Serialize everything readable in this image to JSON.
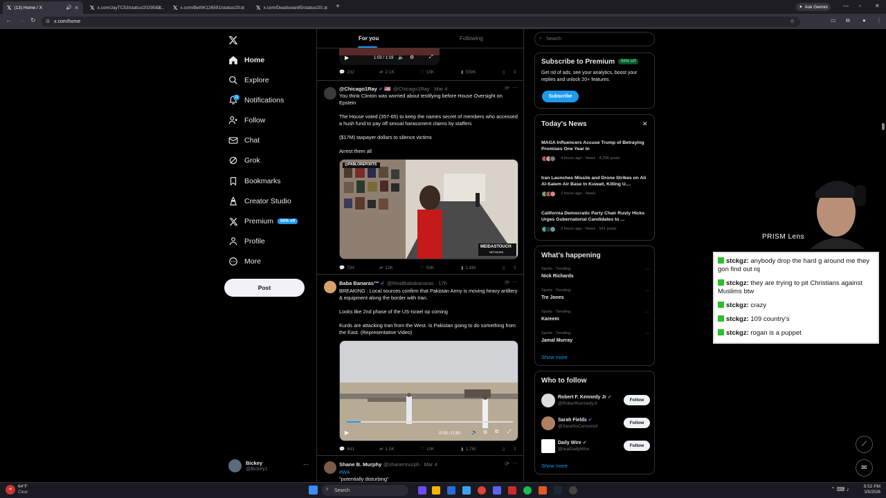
{
  "browser": {
    "tabs": [
      {
        "title": "(13) Home / X",
        "active": true
      },
      {
        "title": "x.com/JayTC53/status/2029583..."
      },
      {
        "title": "x.com/BethK126591/status/20..."
      },
      {
        "title": "x.com/Deadswan85/status/20..."
      }
    ],
    "url": "x.com/home",
    "gemini_label": "Ask Gemini"
  },
  "nav": {
    "items": [
      {
        "label": "Home",
        "icon": "home-icon"
      },
      {
        "label": "Explore",
        "icon": "search-icon"
      },
      {
        "label": "Notifications",
        "icon": "bell-icon"
      },
      {
        "label": "Follow",
        "icon": "person-add-icon"
      },
      {
        "label": "Chat",
        "icon": "mail-icon"
      },
      {
        "label": "Grok",
        "icon": "grok-icon"
      },
      {
        "label": "Bookmarks",
        "icon": "bookmark-icon"
      },
      {
        "label": "Creator Studio",
        "icon": "creator-icon"
      },
      {
        "label": "Premium",
        "icon": "x-logo-icon"
      },
      {
        "label": "Profile",
        "icon": "person-icon"
      },
      {
        "label": "More",
        "icon": "more-circle-icon"
      }
    ],
    "notif_count": "13",
    "premium_badge": "50% off",
    "post_label": "Post",
    "account": {
      "name": "Bickey",
      "handle": "@Bickey1"
    }
  },
  "feed": {
    "tabs": [
      "For you",
      "Following"
    ],
    "top_video": {
      "time": "1:03 / 1:19"
    },
    "top_actions": {
      "replies": "232",
      "reposts": "2.1K",
      "likes": "10K",
      "views": "559K"
    },
    "tweets": [
      {
        "name": "@Chicago1Ray",
        "flag": "🇺🇸",
        "handle": "@Chicago1Ray · Mar 4",
        "paragraphs": [
          "You think Clinton was worried about testifying before House Oversight on Epstein",
          "The House voted (357-65) to keep the names secret of members who accessed a hush fund to pay off sexual harassment claims by staffers",
          "($17M) taxpayer dollars to silence victims",
          "Arrest them all"
        ],
        "media_tag": "@PABLOREPORTS",
        "media_brand": "MEIDASTOUCH",
        "media_brand_sub": "NETWORK",
        "actions": {
          "replies": "794",
          "reposts": "12K",
          "likes": "50K",
          "views": "1.8M"
        }
      },
      {
        "name": "Baba Banaras™",
        "handle": "@RealBababanaras · 17h",
        "paragraphs": [
          "BREAKING : Local sources confirm that Pakistan Army is moving heavy artillery & equipment along the border with Iran.",
          "Looks like 2nd phase of the US-Israel op coming",
          "Kurds are attacking Iran from the West. Is Pakistan going to do something from the East. (Representative Video)"
        ],
        "video_time": "0:03 / 0:30",
        "actions": {
          "replies": "441",
          "reposts": "1.5K",
          "likes": "10K",
          "views": "1.7M"
        }
      },
      {
        "name": "Shane B. Murphy",
        "handle": "@shanermurph · Mar 4",
        "hashtag": "#WA",
        "paragraphs": [
          "\"potentially disturbing\""
        ]
      }
    ]
  },
  "right": {
    "search_placeholder": "Search",
    "premium": {
      "title": "Subscribe to Premium",
      "badge": "50% off",
      "body": "Get rid of ads, see your analytics, boost your replies and unlock 20+ features.",
      "button": "Subscribe"
    },
    "news": {
      "title": "Today's News",
      "items": [
        {
          "headline": "MAGA Influencers Accuse Trump of Betraying Promises One Year In",
          "meta": "4 hours ago · News · 4,296 posts"
        },
        {
          "headline": "Iran Launches Missile and Drone Strikes on Ali Al-Salem Air Base in Kuwait, Killing U....",
          "meta": "2 hours ago · News"
        },
        {
          "headline": "California Democratic Party Chair Rusty Hicks Urges Gubernatorial Candidates to ...",
          "meta": "2 hours ago · News · 541 posts"
        }
      ]
    },
    "happening": {
      "title": "What's happening",
      "items": [
        {
          "context": "Sports · Trending",
          "name": "Nick Richards"
        },
        {
          "context": "Sports · Trending",
          "name": "Tre Jones"
        },
        {
          "context": "Sports · Trending",
          "name": "Kareem"
        },
        {
          "context": "Sports · Trending",
          "name": "Jamal Murray"
        }
      ],
      "show_more": "Show more"
    },
    "who_to_follow": {
      "title": "Who to follow",
      "items": [
        {
          "name": "Robert F. Kennedy Jr",
          "handle": "@RobertKennedyJr",
          "button": "Follow"
        },
        {
          "name": "Sarah Fields",
          "handle": "@SarahIsCensored",
          "button": "Follow"
        },
        {
          "name": "Daily Wire",
          "handle": "@realDailyWire",
          "button": "Follow"
        }
      ],
      "show_more": "Show more"
    }
  },
  "overlay": {
    "brand": "PRISM Lens",
    "chat": [
      {
        "user": "stckgz:",
        "text": "anybody drop the hard g around me they gon find out rq"
      },
      {
        "user": "stckgz:",
        "text": "they are trying to pit Christians against Muslims btw"
      },
      {
        "user": "stckgz:",
        "text": "crazy"
      },
      {
        "user": "stckgz:",
        "text": "109 country's"
      },
      {
        "user": "stckgz:",
        "text": "rogan is a puppet"
      }
    ]
  },
  "taskbar": {
    "weather_temp": "64°F",
    "weather_cond": "Clear",
    "search_label": "Search",
    "time": "9:52 PM",
    "date": "3/5/2026"
  }
}
